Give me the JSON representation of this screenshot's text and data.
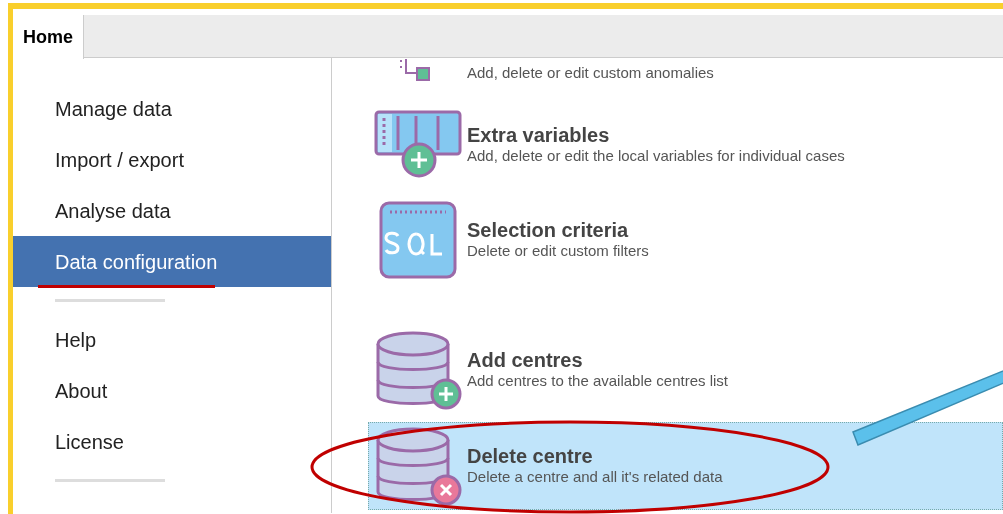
{
  "tabs": [
    {
      "label": "Home",
      "selected": true
    }
  ],
  "sidebar": {
    "items": [
      {
        "kind": "item",
        "label": "Manage data",
        "selected": false
      },
      {
        "kind": "item",
        "label": "Import / export",
        "selected": false
      },
      {
        "kind": "item",
        "label": "Analyse data",
        "selected": false
      },
      {
        "kind": "item",
        "label": "Data configuration",
        "selected": true
      },
      {
        "kind": "divider"
      },
      {
        "kind": "item",
        "label": "Help",
        "selected": false
      },
      {
        "kind": "item",
        "label": "About",
        "selected": false
      },
      {
        "kind": "item",
        "label": "License",
        "selected": false
      },
      {
        "kind": "divider"
      }
    ]
  },
  "options": [
    {
      "kind": "anomaly",
      "description": "Add, delete or edit custom anomalies",
      "selected": false
    },
    {
      "kind": "variables",
      "title": "Extra variables",
      "description": "Add, delete or edit the local variables for individual cases",
      "selected": false
    },
    {
      "kind": "sql",
      "title": "Selection criteria",
      "description": "Delete or edit custom filters",
      "selected": false
    },
    {
      "kind": "db-add",
      "title": "Add centres",
      "description": "Add centres to the available centres list",
      "selected": false
    },
    {
      "kind": "db-delete",
      "title": "Delete centre",
      "description": "Delete a centre and all it's related data",
      "selected": true
    }
  ],
  "annotations": [
    {
      "kind": "underline",
      "color": "#c00000"
    },
    {
      "kind": "ellipse",
      "color": "#c00000"
    },
    {
      "kind": "arrow",
      "color": "#5bc0eb"
    }
  ]
}
